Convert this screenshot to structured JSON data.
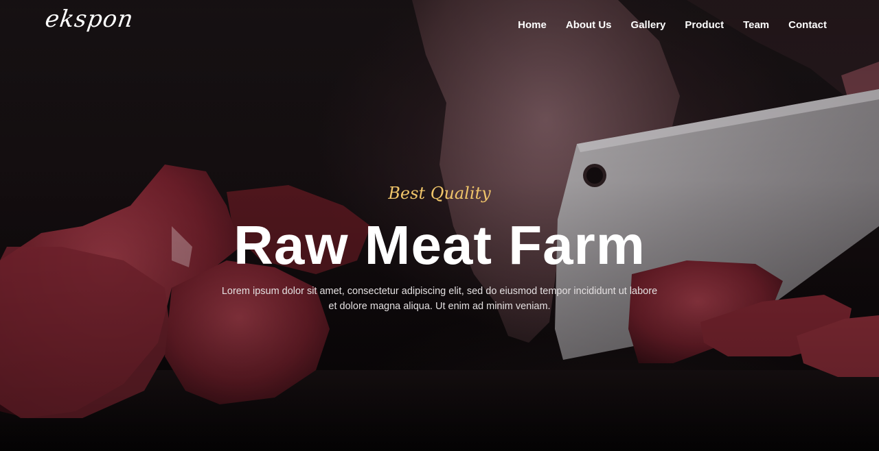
{
  "header": {
    "logo_text": "ekspon",
    "nav": [
      {
        "label": "Home"
      },
      {
        "label": "About Us"
      },
      {
        "label": "Gallery"
      },
      {
        "label": "Product"
      },
      {
        "label": "Team"
      },
      {
        "label": "Contact"
      }
    ]
  },
  "hero": {
    "tagline": "Best Quality",
    "title": "Raw Meat Farm",
    "description_line1": "Lorem ipsum dolor sit amet, consectetur adipiscing elit, sed do eiusmod tempor incididunt ut labore",
    "description_line2": "et dolore magna aliqua. Ut enim ad minim veniam."
  },
  "colors": {
    "accent": "#f0c56a",
    "text": "#ffffff",
    "meat": "#8a2a35"
  }
}
